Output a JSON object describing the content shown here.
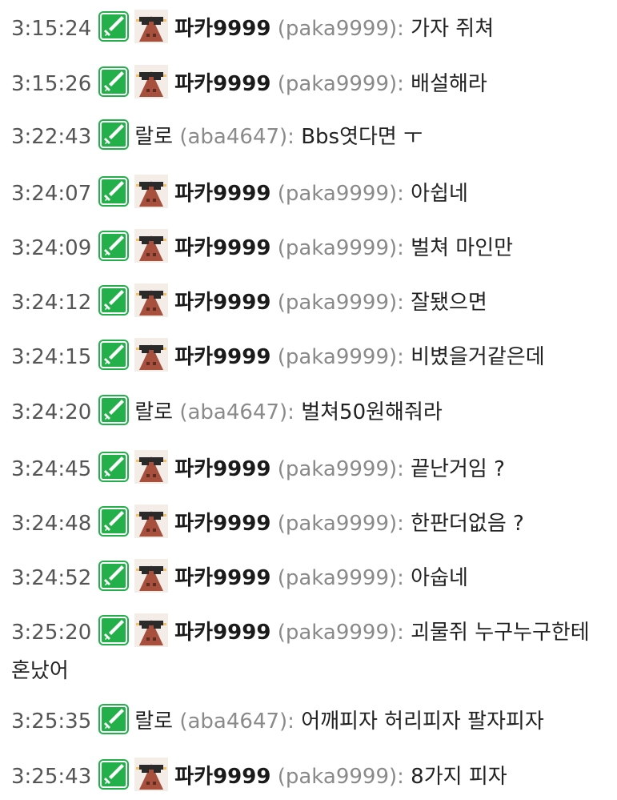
{
  "icons": {
    "badge": "sword-badge-icon",
    "avatar": "pixel-mask-avatar-icon",
    "badge_color": "#23b04a",
    "avatar_color": "#a8503e"
  },
  "messages": [
    {
      "time": "3:15:24",
      "avatar": true,
      "nick": "파카9999",
      "uid": "(paka9999):",
      "text": "가자 쥐쳐"
    },
    {
      "time": "3:15:26",
      "avatar": true,
      "nick": "파카9999",
      "uid": "(paka9999):",
      "text": "배설해라"
    },
    {
      "time": "3:22:43",
      "avatar": false,
      "nick": "랄로",
      "uid": "(aba4647):",
      "text": "Bbs엿다면 ㅜ"
    },
    {
      "time": "3:24:07",
      "avatar": true,
      "nick": "파카9999",
      "uid": "(paka9999):",
      "text": "아쉽네"
    },
    {
      "time": "3:24:09",
      "avatar": true,
      "nick": "파카9999",
      "uid": "(paka9999):",
      "text": "벌쳐 마인만"
    },
    {
      "time": "3:24:12",
      "avatar": true,
      "nick": "파카9999",
      "uid": "(paka9999):",
      "text": "잘됐으면"
    },
    {
      "time": "3:24:15",
      "avatar": true,
      "nick": "파카9999",
      "uid": "(paka9999):",
      "text": "비볐을거같은데"
    },
    {
      "time": "3:24:20",
      "avatar": false,
      "nick": "랄로",
      "uid": "(aba4647):",
      "text": "벌쳐50원해줘라"
    },
    {
      "time": "3:24:45",
      "avatar": true,
      "nick": "파카9999",
      "uid": "(paka9999):",
      "text": "끝난거임 ?"
    },
    {
      "time": "3:24:48",
      "avatar": true,
      "nick": "파카9999",
      "uid": "(paka9999):",
      "text": "한판더없음 ?"
    },
    {
      "time": "3:24:52",
      "avatar": true,
      "nick": "파카9999",
      "uid": "(paka9999):",
      "text": "아숩네"
    },
    {
      "time": "3:25:20",
      "avatar": true,
      "nick": "파카9999",
      "uid": "(paka9999):",
      "text": "괴물쥐 누구누구한테 혼났어"
    },
    {
      "time": "3:25:35",
      "avatar": false,
      "nick": "랄로",
      "uid": "(aba4647):",
      "text": "어깨피자 허리피자 팔자피자"
    },
    {
      "time": "3:25:43",
      "avatar": true,
      "nick": "파카9999",
      "uid": "(paka9999):",
      "text": "8가지 피자"
    }
  ]
}
